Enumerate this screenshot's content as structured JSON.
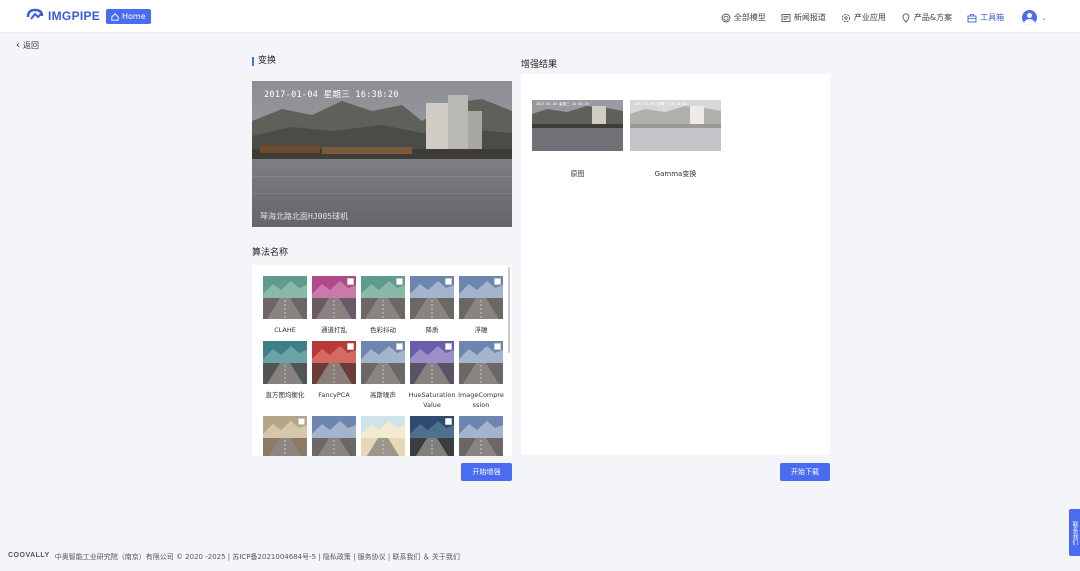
{
  "header": {
    "logo_text": "IMGPIPE",
    "home_label": "Home",
    "nav": [
      {
        "label": "全部模型",
        "icon": "cube-icon"
      },
      {
        "label": "新闻报道",
        "icon": "newspaper-icon"
      },
      {
        "label": "产业应用",
        "icon": "gear-icon"
      },
      {
        "label": "产品&方案",
        "icon": "map-pin-icon"
      },
      {
        "label": "工具箱",
        "icon": "toolbox-icon"
      }
    ],
    "accent": "#4a6cf0"
  },
  "back_label": "返回",
  "transform": {
    "title": "变换",
    "preview_timestamp": "2017-01-04 星期三 16:38:20",
    "preview_caption": "琴海北路北面HJ005球机"
  },
  "algorithms": {
    "title": "算法名称",
    "items": [
      {
        "label": "CLAHE",
        "tone": "teal",
        "checkbox": false
      },
      {
        "label": "通道打乱",
        "tone": "magenta",
        "checkbox": true
      },
      {
        "label": "色彩抖动",
        "tone": "teal",
        "checkbox": true
      },
      {
        "label": "降质",
        "tone": "natural",
        "checkbox": true
      },
      {
        "label": "浮雕",
        "tone": "natural",
        "checkbox": true
      },
      {
        "label": "直方图均衡化",
        "tone": "teal2",
        "checkbox": false
      },
      {
        "label": "FancyPCA",
        "tone": "red",
        "checkbox": true
      },
      {
        "label": "高斯噪声",
        "tone": "natural",
        "checkbox": true
      },
      {
        "label": "HueSaturationValue",
        "tone": "purple",
        "checkbox": true
      },
      {
        "label": "ImageCompression",
        "tone": "natural",
        "checkbox": true
      },
      {
        "label": "",
        "tone": "sepia",
        "checkbox": true
      },
      {
        "label": "",
        "tone": "natural",
        "checkbox": false
      },
      {
        "label": "",
        "tone": "bright",
        "checkbox": false
      },
      {
        "label": "",
        "tone": "dark",
        "checkbox": true
      },
      {
        "label": "",
        "tone": "natural",
        "checkbox": false
      }
    ]
  },
  "result": {
    "title": "增强结果",
    "items": [
      {
        "label": "原图",
        "variant": "original"
      },
      {
        "label": "Gamma变换",
        "variant": "gamma"
      }
    ]
  },
  "buttons": {
    "start_enhance": "开始增强",
    "start_download": "开始下载"
  },
  "side_contact": "联系我们",
  "footer": {
    "brand": "COOVALLY",
    "text": "中奥智能工业研究院（南京）有限公司 © 2020 -2025 | 苏ICP备2021004684号-5 | 隐私政策 | 服务协议 | 联系我们 ＆ 关于我们"
  }
}
